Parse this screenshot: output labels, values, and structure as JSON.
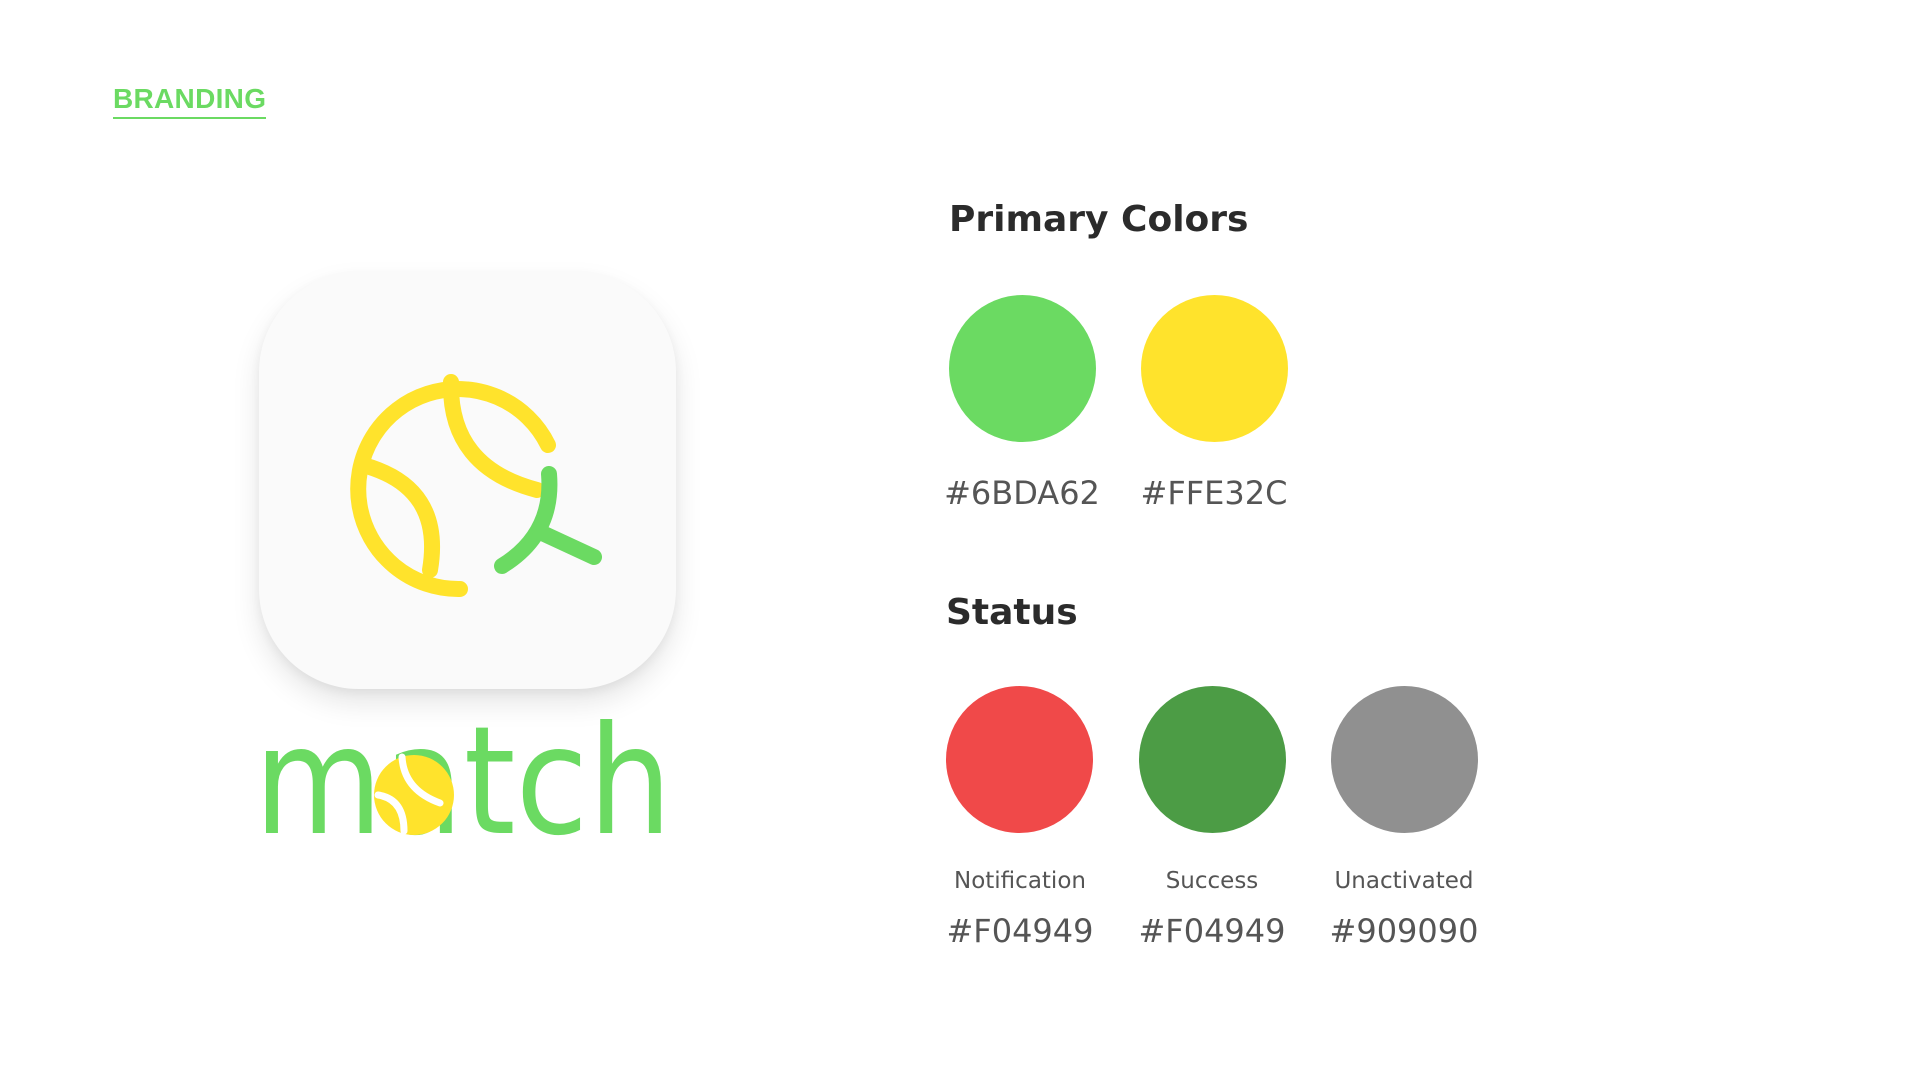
{
  "header": {
    "label": "BRANDING",
    "accent_color": "#6BDA62"
  },
  "logo": {
    "app_icon_name": "tennis-ball-search-icon",
    "wordmark_text": "match",
    "wordmark_color": "#6BDA62",
    "accent_letter_color": "#FFE32C"
  },
  "primary_colors": {
    "title": "Primary Colors",
    "swatches": [
      {
        "hex": "#6BDA62",
        "color": "#6BDA62"
      },
      {
        "hex": "#FFE32C",
        "color": "#FFE32C"
      }
    ]
  },
  "status": {
    "title": "Status",
    "swatches": [
      {
        "label": "Notification",
        "hex": "#F04949",
        "color": "#F04949"
      },
      {
        "label": "Success",
        "hex": "#F04949",
        "color": "#4C9C45"
      },
      {
        "label": "Unactivated",
        "hex": "#909090",
        "color": "#909090"
      }
    ]
  }
}
